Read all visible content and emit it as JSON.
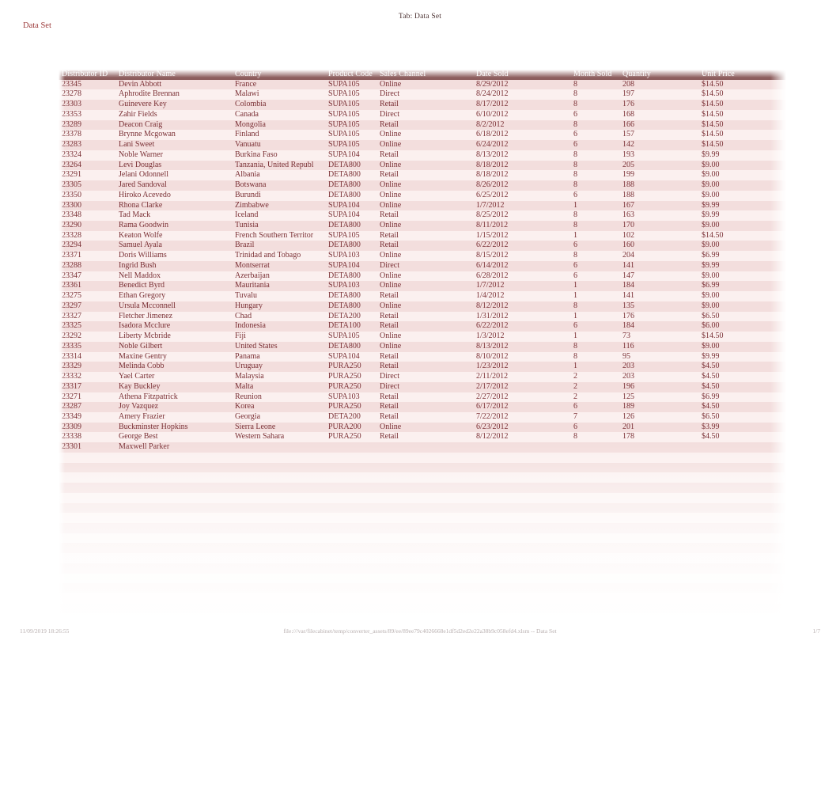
{
  "header": {
    "tab_label": "Tab: Data Set",
    "sheet_title": "Data Set"
  },
  "table": {
    "columns": [
      "Distributor ID",
      "Distributor Name",
      "Country",
      "Product Code",
      "Sales Channel",
      "Date Sold",
      "Month Sold",
      "Quantity",
      "Unit Price"
    ],
    "rows": [
      [
        "23345",
        "Devin Abbott",
        "France",
        "SUPA105",
        "Online",
        "8/29/2012",
        "8",
        "208",
        "$14.50"
      ],
      [
        "23278",
        "Aphrodite Brennan",
        "Malawi",
        "SUPA105",
        "Direct",
        "8/24/2012",
        "8",
        "197",
        "$14.50"
      ],
      [
        "23303",
        "Guinevere Key",
        "Colombia",
        "SUPA105",
        "Retail",
        "8/17/2012",
        "8",
        "176",
        "$14.50"
      ],
      [
        "23353",
        "Zahir Fields",
        "Canada",
        "SUPA105",
        "Direct",
        "6/10/2012",
        "6",
        "168",
        "$14.50"
      ],
      [
        "23289",
        "Deacon Craig",
        "Mongolia",
        "SUPA105",
        "Retail",
        "8/2/2012",
        "8",
        "166",
        "$14.50"
      ],
      [
        "23378",
        "Brynne Mcgowan",
        "Finland",
        "SUPA105",
        "Online",
        "6/18/2012",
        "6",
        "157",
        "$14.50"
      ],
      [
        "23283",
        "Lani Sweet",
        "Vanuatu",
        "SUPA105",
        "Online",
        "6/24/2012",
        "6",
        "142",
        "$14.50"
      ],
      [
        "23324",
        "Noble Warner",
        "Burkina Faso",
        "SUPA104",
        "Retail",
        "8/13/2012",
        "8",
        "193",
        "$9.99"
      ],
      [
        "23264",
        "Levi Douglas",
        "Tanzania, United Republ",
        "DETA800",
        "Online",
        "8/18/2012",
        "8",
        "205",
        "$9.00"
      ],
      [
        "23291",
        "Jelani Odonnell",
        "Albania",
        "DETA800",
        "Retail",
        "8/18/2012",
        "8",
        "199",
        "$9.00"
      ],
      [
        "23305",
        "Jared Sandoval",
        "Botswana",
        "DETA800",
        "Online",
        "8/26/2012",
        "8",
        "188",
        "$9.00"
      ],
      [
        "23350",
        "Hiroko Acevedo",
        "Burundi",
        "DETA800",
        "Online",
        "6/25/2012",
        "6",
        "188",
        "$9.00"
      ],
      [
        "23300",
        "Rhona Clarke",
        "Zimbabwe",
        "SUPA104",
        "Online",
        "1/7/2012",
        "1",
        "167",
        "$9.99"
      ],
      [
        "23348",
        "Tad Mack",
        "Iceland",
        "SUPA104",
        "Retail",
        "8/25/2012",
        "8",
        "163",
        "$9.99"
      ],
      [
        "23290",
        "Rama Goodwin",
        "Tunisia",
        "DETA800",
        "Online",
        "8/11/2012",
        "8",
        "170",
        "$9.00"
      ],
      [
        "23328",
        "Keaton Wolfe",
        "French Southern Territor",
        "SUPA105",
        "Retail",
        "1/15/2012",
        "1",
        "102",
        "$14.50"
      ],
      [
        "23294",
        "Samuel Ayala",
        "Brazil",
        "DETA800",
        "Retail",
        "6/22/2012",
        "6",
        "160",
        "$9.00"
      ],
      [
        "23371",
        "Doris Williams",
        "Trinidad and Tobago",
        "SUPA103",
        "Online",
        "8/15/2012",
        "8",
        "204",
        "$6.99"
      ],
      [
        "23288",
        "Ingrid Bush",
        "Montserrat",
        "SUPA104",
        "Direct",
        "6/14/2012",
        "6",
        "141",
        "$9.99"
      ],
      [
        "23347",
        "Nell Maddox",
        "Azerbaijan",
        "DETA800",
        "Online",
        "6/28/2012",
        "6",
        "147",
        "$9.00"
      ],
      [
        "23361",
        "Benedict Byrd",
        "Mauritania",
        "SUPA103",
        "Online",
        "1/7/2012",
        "1",
        "184",
        "$6.99"
      ],
      [
        "23275",
        "Ethan Gregory",
        "Tuvalu",
        "DETA800",
        "Retail",
        "1/4/2012",
        "1",
        "141",
        "$9.00"
      ],
      [
        "23297",
        "Ursula Mcconnell",
        "Hungary",
        "DETA800",
        "Online",
        "8/12/2012",
        "8",
        "135",
        "$9.00"
      ],
      [
        "23327",
        "Fletcher Jimenez",
        "Chad",
        "DETA200",
        "Retail",
        "1/31/2012",
        "1",
        "176",
        "$6.50"
      ],
      [
        "23325",
        "Isadora Mcclure",
        "Indonesia",
        "DETA100",
        "Retail",
        "6/22/2012",
        "6",
        "184",
        "$6.00"
      ],
      [
        "23292",
        "Liberty Mcbride",
        "Fiji",
        "SUPA105",
        "Online",
        "1/3/2012",
        "1",
        "73",
        "$14.50"
      ],
      [
        "23335",
        "Noble Gilbert",
        "United States",
        "DETA800",
        "Online",
        "8/13/2012",
        "8",
        "116",
        "$9.00"
      ],
      [
        "23314",
        "Maxine Gentry",
        "Panama",
        "SUPA104",
        "Retail",
        "8/10/2012",
        "8",
        "95",
        "$9.99"
      ],
      [
        "23329",
        "Melinda Cobb",
        "Uruguay",
        "PURA250",
        "Retail",
        "1/23/2012",
        "1",
        "203",
        "$4.50"
      ],
      [
        "23332",
        "Yael Carter",
        "Malaysia",
        "PURA250",
        "Direct",
        "2/11/2012",
        "2",
        "203",
        "$4.50"
      ],
      [
        "23317",
        "Kay Buckley",
        "Malta",
        "PURA250",
        "Direct",
        "2/17/2012",
        "2",
        "196",
        "$4.50"
      ],
      [
        "23271",
        "Athena Fitzpatrick",
        "Reunion",
        "SUPA103",
        "Retail",
        "2/27/2012",
        "2",
        "125",
        "$6.99"
      ],
      [
        "23287",
        "Joy Vazquez",
        "Korea",
        "PURA250",
        "Retail",
        "6/17/2012",
        "6",
        "189",
        "$4.50"
      ],
      [
        "23349",
        "Amery Frazier",
        "Georgia",
        "DETA200",
        "Retail",
        "7/22/2012",
        "7",
        "126",
        "$6.50"
      ],
      [
        "23309",
        "Buckminster Hopkins",
        "Sierra Leone",
        "PURA200",
        "Online",
        "6/23/2012",
        "6",
        "201",
        "$3.99"
      ],
      [
        "23338",
        "George Best",
        "Western Sahara",
        "PURA250",
        "Retail",
        "8/12/2012",
        "8",
        "178",
        "$4.50"
      ],
      [
        "23301",
        "Maxwell Parker",
        "",
        "",
        "",
        "",
        "",
        "",
        ""
      ]
    ],
    "faded_rows": [
      [
        "",
        "",
        "",
        "",
        "",
        "",
        "",
        "",
        ""
      ],
      [
        "",
        "",
        "",
        "",
        "",
        "",
        "",
        "",
        ""
      ],
      [
        "",
        "",
        "",
        "",
        "",
        "",
        "",
        "",
        ""
      ],
      [
        "",
        "",
        "",
        "",
        "",
        "",
        "",
        "",
        ""
      ],
      [
        "",
        "",
        "",
        "",
        "",
        "",
        "",
        "",
        ""
      ],
      [
        "",
        "",
        "",
        "",
        "",
        "",
        "",
        "",
        ""
      ],
      [
        "",
        "",
        "",
        "",
        "",
        "",
        "",
        "",
        ""
      ],
      [
        "",
        "",
        "",
        "",
        "",
        "",
        "",
        "",
        ""
      ],
      [
        "",
        "",
        "",
        "",
        "",
        "",
        "",
        "",
        ""
      ],
      [
        "",
        "",
        "",
        "",
        "",
        "",
        "",
        "",
        ""
      ],
      [
        "",
        "",
        "",
        "",
        "",
        "",
        "",
        "",
        ""
      ],
      [
        "",
        "",
        "",
        "",
        "",
        "",
        "",
        "",
        ""
      ],
      [
        "",
        "",
        "",
        "",
        "",
        "",
        "",
        "",
        ""
      ],
      [
        "",
        "",
        "",
        "",
        "",
        "",
        "",
        "",
        ""
      ],
      [
        "",
        "",
        "",
        "",
        "",
        "",
        "",
        "",
        ""
      ],
      [
        "",
        "",
        "",
        "",
        "",
        "",
        "",
        "",
        ""
      ],
      [
        "",
        "",
        "",
        "",
        "",
        "",
        "",
        "",
        ""
      ]
    ]
  },
  "footer": {
    "timestamp": "11/09/2019 18:26:55",
    "path": "file:///var/filecabinet/temp/converter_assets/89/ee/89ee79c4026668e1df5d2ed2e22a38b9c058efd4.xlsm -- Data Set",
    "page": "1/7"
  },
  "colors": {
    "header_bar": "#8d5e5e",
    "row_odd": "#f3dedd",
    "row_even": "#fbf0ef",
    "text": "#7a2f34",
    "title": "#9b3a3a"
  }
}
